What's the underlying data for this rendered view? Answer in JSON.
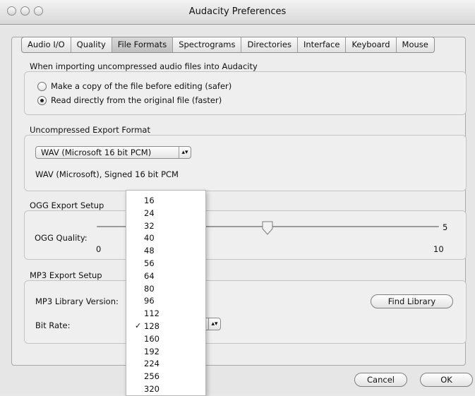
{
  "window": {
    "title": "Audacity Preferences"
  },
  "tabs": [
    {
      "label": "Audio I/O"
    },
    {
      "label": "Quality"
    },
    {
      "label": "File Formats",
      "active": true
    },
    {
      "label": "Spectrograms"
    },
    {
      "label": "Directories"
    },
    {
      "label": "Interface"
    },
    {
      "label": "Keyboard"
    },
    {
      "label": "Mouse"
    }
  ],
  "import_section": {
    "label": "When importing uncompressed audio files into Audacity",
    "options": [
      {
        "label": "Make a copy of the file before editing (safer)",
        "selected": false
      },
      {
        "label": "Read directly from the original file (faster)",
        "selected": true
      }
    ]
  },
  "export_format": {
    "label": "Uncompressed Export Format",
    "selected": "WAV (Microsoft 16 bit PCM)",
    "description": "WAV (Microsoft), Signed 16 bit PCM"
  },
  "ogg": {
    "label": "OGG Export Setup",
    "quality_label": "OGG Quality:",
    "min": "0",
    "max": "10",
    "value": "5"
  },
  "mp3": {
    "label": "MP3 Export Setup",
    "library_label": "MP3 Library Version:",
    "find_library": "Find Library",
    "bitrate_label": "Bit Rate:",
    "bitrate_selected": "128"
  },
  "bitrate_menu": {
    "items": [
      "16",
      "24",
      "32",
      "40",
      "48",
      "56",
      "64",
      "80",
      "96",
      "112",
      "128",
      "160",
      "192",
      "224",
      "256",
      "320"
    ],
    "checked": "128",
    "check_glyph": "✓"
  },
  "footer": {
    "cancel": "Cancel",
    "ok": "OK"
  }
}
